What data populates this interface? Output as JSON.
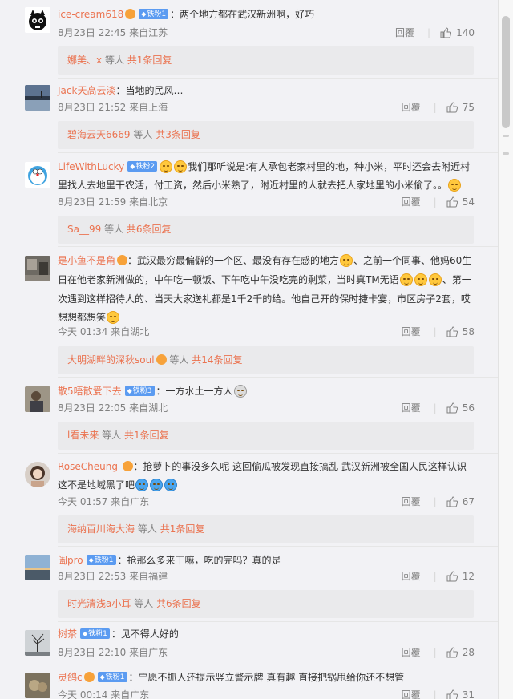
{
  "labels": {
    "reply": "回覆",
    "sep": "|",
    "etc": "等人",
    "from": "来自"
  },
  "comments": [
    {
      "user": "ice-cream618",
      "badge": "铁粉1",
      "text": "：两个地方都在武汉新洲啊，好巧",
      "time": "8月23日 22:45",
      "loc": "来自江苏",
      "likes": "140",
      "reply_user": "娜美、x",
      "reply_count": "共1条回复",
      "avatar": "black-cat-avatar"
    },
    {
      "user": "Jack天高云淡",
      "badge": "",
      "text": "：当地的民风…",
      "time": "8月23日 21:52",
      "loc": "来自上海",
      "likes": "75",
      "reply_user": "碧海云天6669",
      "reply_count": "共3条回复",
      "avatar": "lake-avatar"
    },
    {
      "user": "LifeWithLucky",
      "badge": "铁粉2",
      "text_a": "我们那听说是:有人承包老家村里的地，种小米，平时还会去附近村",
      "text_b": "里找人去地里干农活，付工资，然后小米熟了，附近村里的人就去把人家地里的小米偷了。。",
      "time": "8月23日 21:59",
      "loc": "来自北京",
      "likes": "54",
      "reply_user": "Sa__99",
      "reply_count": "共6条回复",
      "avatar": "doraemon-avatar"
    },
    {
      "user": "是小鱼不是角",
      "badge": "",
      "text_a": "：武汉最穷最偏僻的一个区、最没有存在感的地方",
      "text_a2": "、之前一个同事、他妈60生",
      "text_b": "日在他老家新洲做的，中午吃一顿饭、下午吃中午没吃完的剩菜，当时真TM无语",
      "text_b2": "、第一",
      "text_c": "次遇到这样招待人的、当天大家送礼都是1千2千的给。他自己开的保时捷卡宴，市区房子2套，哎",
      "text_d": "想想都想笑",
      "time": "今天 01:34",
      "loc": "来自湖北",
      "likes": "58",
      "reply_user": "大明湖畔的深秋soul",
      "reply_count": "共14条回复",
      "avatar": "room-avatar"
    },
    {
      "user": "散5唔散爱下去",
      "badge": "铁粉3",
      "text": "：一方水土一方人",
      "time": "8月23日 22:05",
      "loc": "来自湖北",
      "likes": "56",
      "reply_user": "l看未来",
      "reply_count": "共1条回复",
      "avatar": "outdoor-avatar"
    },
    {
      "user": "RoseCheung-",
      "badge": "",
      "text_a": "：抢萝卜的事没多久呢 这回偷瓜被发现直接搞乱 武汉新洲被全国人民这样认识",
      "text_b": "这不是地域黑了吧",
      "time": "今天 01:57",
      "loc": "来自广东",
      "likes": "67",
      "reply_user": "海纳百川海大海",
      "reply_count": "共1条回复",
      "avatar": "woman-avatar"
    },
    {
      "user": "阖pro",
      "badge": "铁粉1",
      "text": "：抢那么多来干嘛，吃的完吗？真的是",
      "time": "8月23日 22:53",
      "loc": "来自福建",
      "likes": "12",
      "reply_user": "时光清浅a小耳",
      "reply_count": "共6条回复",
      "avatar": "sunset-avatar"
    },
    {
      "user": "树茶",
      "badge": "铁粉1",
      "text": "：见不得人好的",
      "time": "8月23日 22:10",
      "loc": "来自广东",
      "likes": "28",
      "avatar": "tree-avatar"
    },
    {
      "user": "灵鸽c",
      "badge": "铁粉1",
      "text": "：宁愿不抓人还提示竖立警示牌 真有趣 直接把锅甩给你还不想管",
      "time": "今天 00:14",
      "loc": "来自广东",
      "likes": "31",
      "avatar": "cat-avatar"
    }
  ]
}
